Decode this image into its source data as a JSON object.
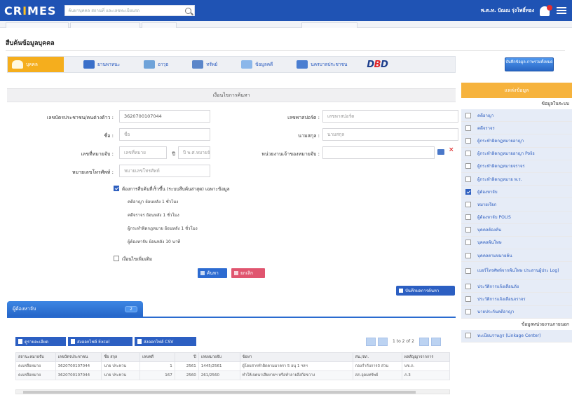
{
  "header": {
    "logo": "CRIMES",
    "search_placeholder": "ค้นหาบุคคล สถานที่ และเลขทะเบียนรถ",
    "user_name": "พ.ต.ท. ปัณณ รุ่งโพธิ์ทอง"
  },
  "page": {
    "title": "สืบค้นข้อมูลบุคคล"
  },
  "tabs": [
    {
      "label": "บุคคล",
      "active": true,
      "color": "#f5ae1d"
    },
    {
      "label": "ยานพาหนะ",
      "active": false,
      "color": "#3a6fc9"
    },
    {
      "label": "อาวุธ",
      "active": false,
      "color": "#6fa3d9"
    },
    {
      "label": "ทรัพย์",
      "active": false,
      "color": "#5b86c9"
    },
    {
      "label": "ข้อมูลคดี",
      "active": false,
      "color": "#8bb7ea"
    },
    {
      "label": "นครบาลประชาชน",
      "active": false,
      "color": "#4a7ed1"
    }
  ],
  "dbd_logo": {
    "left": "D",
    "mid": "B",
    "right": "D"
  },
  "view_all_button": "บันทึกข้อมูล ภาพรวมทั้งหมด",
  "form": {
    "heading": "เงื่อนไขการค้นหา",
    "id_label": "เลขบัตรประชาชน/คนต่างด้าว :",
    "id_value": "3620700107044",
    "passport_label": "เลขพาสปอร์ต :",
    "passport_placeholder": "เลขพาสปอร์ต",
    "name_label": "ชื่อ :",
    "name_placeholder": "ชื่อ",
    "surname_label": "นามสกุล :",
    "surname_placeholder": "นามสกุล",
    "warrant_label": "เลขที่หมายจับ :",
    "warrant_placeholder": "เลขที่หมาย",
    "year_label": "ปี",
    "year_placeholder": "ปี พ.ศ.หมายจับ",
    "agency_label": "หน่วยงานเจ้าของหมายจับ :",
    "phone_label": "หมายเลขโทรศัพท์ :",
    "phone_placeholder": "หมายเลขโทรศัพท์",
    "fast_check_label": "ต้องการสืบค้นที่เร็วขึ้น (ระบบสืบค้นล่าสุด) เฉพาะข้อมูล",
    "fast_options": [
      "คดีอาญา ย้อนหลัง 1 ชั่วโมง",
      "คดีจราจร ย้อนหลัง 1 ชั่วโมง",
      "ผู้กระทำผิดกฎหมาย ย้อนหลัง 1 ชั่วโมง",
      "ผู้ต้องหาจับ ย้อนหลัง 10 นาที"
    ],
    "extra_label": "เงื่อนไขเพิ่มเติม",
    "search_button": "ค้นหา",
    "clear_button": "ยกเลิก",
    "save_button": "บันทึกผลการค้นหา"
  },
  "results": {
    "tab_label": "ผู้ต้องหาจับ",
    "count": "2",
    "export_buttons": [
      "ดูรายละเอียด",
      "ส่งออกไฟล์ Excel",
      "ส่งออกไฟล์ CSV"
    ],
    "pager_text": "1 to 2 of 2",
    "columns": [
      "สถานะหมายจับ",
      "เลขบัตรประชาชน",
      "ชื่อ สกุล",
      "เลขคดี",
      "ปี",
      "เลขหมายจับ",
      "ข้อหา",
      "สน./สภ.",
      "ผลสัญญาจากการ"
    ],
    "rows": [
      [
        "คงเหลือหมาย",
        "3620700107044",
        "นาย ประทวน",
        "1",
        "2561",
        "1445/2561",
        "ผู้โดยสารทำผิดตามมาตรา 5 อนุ 1 ฯลฯ",
        "กองกำกับการ3 ส่วน",
        "บช.ภ."
      ],
      [
        "คงเหลือหมาย",
        "3620700107044",
        "นาย ประทวน",
        "167",
        "2560",
        "261/2560",
        "ทำให้เจตนาเสียหายฯ หรือทำลายสิ่งกีดขวาง",
        "สภ.อุดมทรัพย์",
        "ภ.3"
      ]
    ]
  },
  "sidebar": {
    "heading": "แหล่งข้อมูล",
    "subheading": "ข้อมูลในระบบ",
    "items": [
      {
        "label": "คดีอาญา",
        "checked": false
      },
      {
        "label": "คดีจราจร",
        "checked": false
      },
      {
        "label": "ผู้กระทำผิดกฎหมายอาญา",
        "checked": false
      },
      {
        "label": "ผู้กระทำผิดกฎหมายอาญา Polis",
        "checked": false
      },
      {
        "label": "ผู้กระทำผิดกฎหมายจราจร",
        "checked": false
      },
      {
        "label": "ผู้กระทำผิดกฎหมาย พ.ร.",
        "checked": false
      },
      {
        "label": "ผู้ต้องหาจับ",
        "checked": true
      },
      {
        "label": "หมายเรียก",
        "checked": false
      },
      {
        "label": "ผู้ต้องหาจับ POLIS",
        "checked": false
      },
      {
        "label": "บุคคลต้องค้น",
        "checked": false
      },
      {
        "label": "บุคคลพ้นโทษ",
        "checked": false
      },
      {
        "label": "บุคคลตามหมายค้น",
        "checked": false
      },
      {
        "label": "เบอร์โทรศัพท์จากพ้นโทษ ประสานผู้ประ Log)",
        "checked": false,
        "multi": true
      },
      {
        "label": "ประวัติการแจ้งเตือนภัย",
        "checked": false
      },
      {
        "label": "ประวัติการแจ้งเตือนจราจร",
        "checked": false
      },
      {
        "label": "นายประกันคดีอาญา",
        "checked": false
      }
    ],
    "footer_sub": "ข้อมูลหน่วยงานภายนอก",
    "footer_item": "ทะเบียนราษฎร (Linkage Center)"
  }
}
